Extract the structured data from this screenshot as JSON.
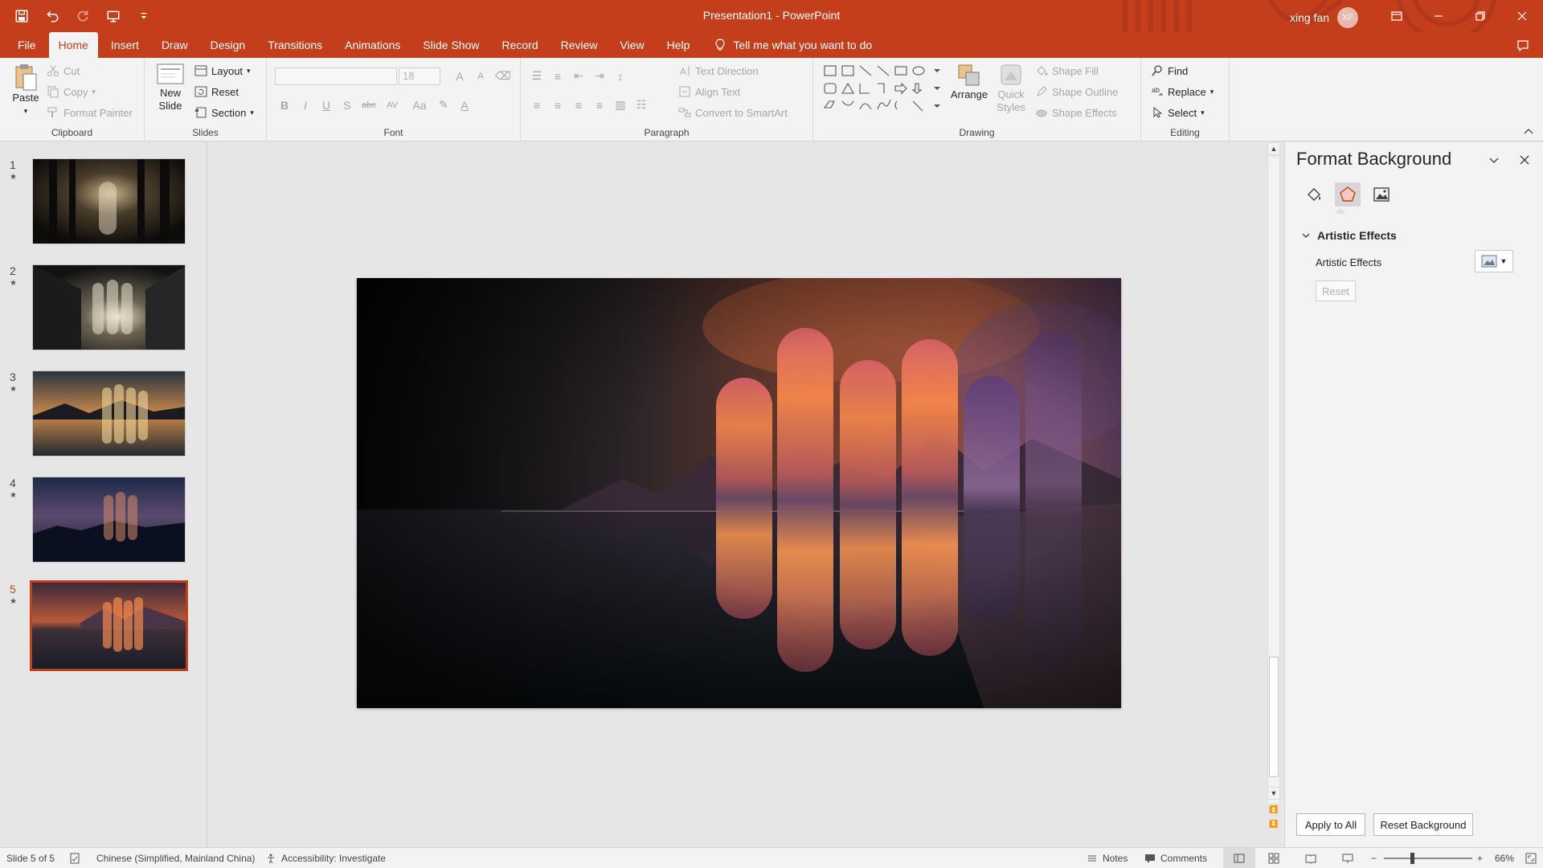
{
  "window": {
    "title": "Presentation1  -  PowerPoint",
    "user_name": "xing fan",
    "user_initials": "XF"
  },
  "tabs": [
    "File",
    "Home",
    "Insert",
    "Draw",
    "Design",
    "Transitions",
    "Animations",
    "Slide Show",
    "Record",
    "Review",
    "View",
    "Help"
  ],
  "active_tab": "Home",
  "tell_me": "Tell me what you want to do",
  "ribbon": {
    "clipboard": {
      "paste": "Paste",
      "cut": "Cut",
      "copy": "Copy",
      "format_painter": "Format Painter",
      "label": "Clipboard"
    },
    "slides": {
      "new_slide_line1": "New",
      "new_slide_line2": "Slide",
      "layout": "Layout",
      "reset": "Reset",
      "section": "Section",
      "label": "Slides"
    },
    "font": {
      "size": "18",
      "label": "Font",
      "bold": "B",
      "italic": "I",
      "underline": "U",
      "strike": "S",
      "grow": "A",
      "shrink": "A",
      "case": "Aa",
      "spacing": "AV",
      "color": "A"
    },
    "paragraph": {
      "text_direction": "Text Direction",
      "align_text": "Align Text",
      "convert_smartart": "Convert to SmartArt",
      "label": "Paragraph"
    },
    "drawing": {
      "arrange": "Arrange",
      "quick_styles_line1": "Quick",
      "quick_styles_line2": "Styles",
      "shape_fill": "Shape Fill",
      "shape_outline": "Shape Outline",
      "shape_effects": "Shape Effects",
      "label": "Drawing"
    },
    "editing": {
      "find": "Find",
      "replace": "Replace",
      "select": "Select",
      "label": "Editing"
    }
  },
  "slides": [
    {
      "number": "1",
      "star": "★"
    },
    {
      "number": "2",
      "star": "★"
    },
    {
      "number": "3",
      "star": "★"
    },
    {
      "number": "4",
      "star": "★"
    },
    {
      "number": "5",
      "star": "★"
    }
  ],
  "selected_slide": 5,
  "format_pane": {
    "title": "Format Background",
    "section": "Artistic Effects",
    "artistic_label": "Artistic Effects",
    "reset": "Reset",
    "apply_all": "Apply to All",
    "reset_background": "Reset Background"
  },
  "status": {
    "slide_info": "Slide 5 of 5",
    "language": "Chinese (Simplified, Mainland China)",
    "accessibility": "Accessibility: Investigate",
    "notes": "Notes",
    "comments": "Comments",
    "zoom": "66%"
  },
  "colors": {
    "accent": "#c43e1c",
    "ribbon_bg": "#f3f3f3",
    "workspace_bg": "#e6e6e6"
  }
}
